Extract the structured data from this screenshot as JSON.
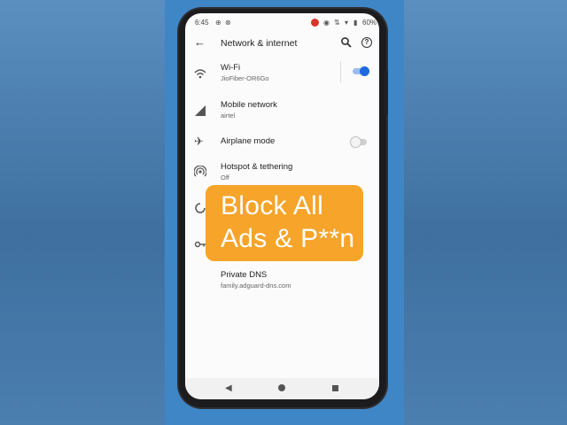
{
  "status_bar": {
    "time": "6:45",
    "battery": "60%",
    "notification_badge": "●"
  },
  "app_bar": {
    "title": "Network & internet",
    "back_icon": "arrow-back-icon",
    "search_icon": "search-icon",
    "help_icon": "help-icon",
    "help_glyph": "?"
  },
  "settings": {
    "wifi": {
      "title": "Wi-Fi",
      "subtitle": "JioFiber-OR6Go",
      "enabled": true
    },
    "mobile_network": {
      "title": "Mobile network",
      "subtitle": "airtel"
    },
    "airplane_mode": {
      "title": "Airplane mode",
      "enabled": false
    },
    "hotspot": {
      "title": "Hotspot & tethering",
      "subtitle": "Off"
    },
    "private_dns": {
      "title": "Private DNS",
      "subtitle": "family.adguard-dns.com"
    }
  },
  "overlay": {
    "line1": "Block All",
    "line2": "Ads & P**n",
    "color": "#f6a42a"
  },
  "nav_bar": {
    "back_glyph": "◀"
  },
  "colors": {
    "accent": "#1e6be0",
    "background": "#3f86c7"
  }
}
